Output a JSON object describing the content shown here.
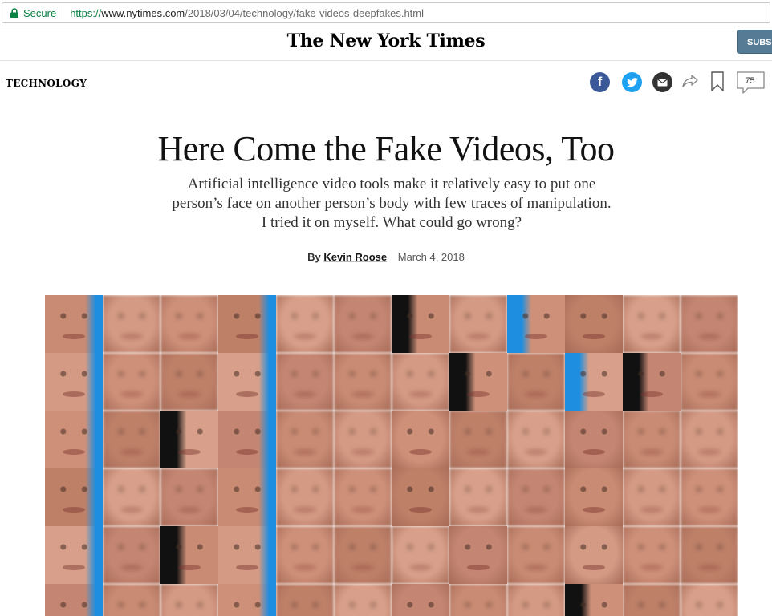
{
  "browser": {
    "secure_label": "Secure",
    "url_scheme": "https://",
    "url_host": "www.nytimes.com",
    "url_path": "/2018/03/04/technology/fake-videos-deepfakes.html"
  },
  "masthead": {
    "logo": "The New York Times",
    "subscribe_label": "SUBSC"
  },
  "section": {
    "label": "TECHNOLOGY"
  },
  "share": {
    "facebook_icon": "f",
    "comment_count": "75"
  },
  "article": {
    "headline": "Here Come the Fake Videos, Too",
    "summary": "Artificial intelligence video tools make it relatively easy to put one person’s face on another person’s body with few traces of manipulation. I tried it on myself. What could go wrong?",
    "byline_prefix": "By",
    "author": "Kevin Roose",
    "date": "March 4, 2018"
  },
  "colors": {
    "secure_green": "#0b8043",
    "subscribe_bg": "#567b95",
    "facebook": "#3b5998",
    "twitter": "#1da1f2",
    "email": "#333333",
    "grid_blue": "#1e8ee0"
  },
  "icons": {
    "lock": "lock-icon",
    "facebook": "facebook-icon",
    "twitter": "twitter-icon",
    "email": "email-icon",
    "share": "share-icon",
    "bookmark": "bookmark-icon",
    "comments": "comments-icon"
  }
}
